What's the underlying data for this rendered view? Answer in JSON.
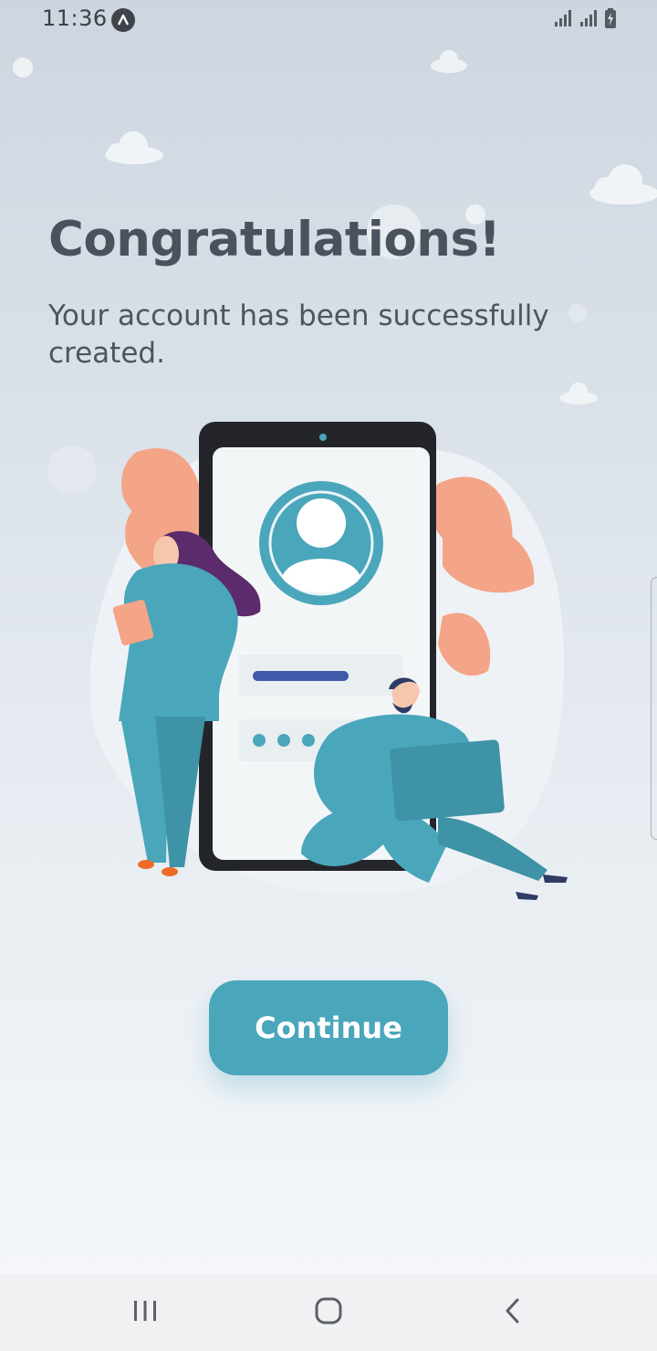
{
  "status_bar": {
    "time": "11:36"
  },
  "content": {
    "title": "Congratulations!",
    "message": "Your account has been successfully created."
  },
  "actions": {
    "continue_label": "Continue"
  },
  "colors": {
    "accent": "#4aa6bb",
    "text_primary": "#4a525d",
    "nav_background": "#f1f1f3"
  },
  "icons": {
    "status_app": "app-indicator-icon",
    "signal": "signal-icon",
    "battery": "battery-charging-icon",
    "nav_recents": "recent-apps-icon",
    "nav_home": "home-icon",
    "nav_back": "back-icon"
  }
}
